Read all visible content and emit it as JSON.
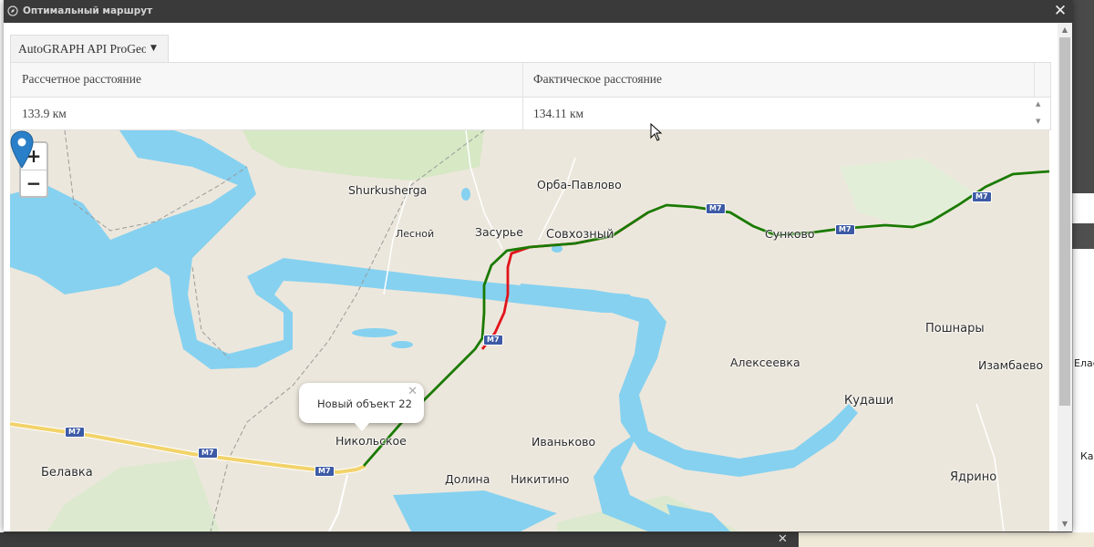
{
  "window": {
    "title": "Оптимальный маршрут",
    "close_icon": "close-icon",
    "title_icon": "compass-icon"
  },
  "provider": {
    "selected": "AutoGRAPH API ProGeo",
    "arrow_icon": "caret-down-icon"
  },
  "table": {
    "headers": [
      "Рассчетное расстояние",
      "Фактическое расстояние"
    ],
    "rows": [
      [
        "133.9 км",
        "134.11 км"
      ]
    ]
  },
  "map": {
    "zoom_in_label": "+",
    "zoom_out_label": "−",
    "places": {
      "shurkusherga": "Shurkusherga",
      "orba_pavlovo": "Орба-Павлово",
      "lesnoy": "Лесной",
      "zasurye": "Засурье",
      "sovkhozny": "Совхозный",
      "sunkovo": "Сунково",
      "poshnary": "Пошнары",
      "alekseevka": "Алексеевка",
      "izambaevo": "Изамбаево",
      "kudashi": "Кудаши",
      "nikolskoe": "Никольское",
      "ivankovo": "Иваньково",
      "belavka": "Белавка",
      "dolina": "Долина",
      "nikitino": "Никитино",
      "yadrino": "Ядрино"
    },
    "highway_shield": "M7",
    "popup_text": "Новый объект 22",
    "route_colors": {
      "calculated": "#1a7a00",
      "actual": "#e2141c",
      "water": "#86d1f0",
      "road": "#f2d36b"
    }
  },
  "background": {
    "right_label_1": "Елас",
    "right_label_2": "Кар"
  }
}
